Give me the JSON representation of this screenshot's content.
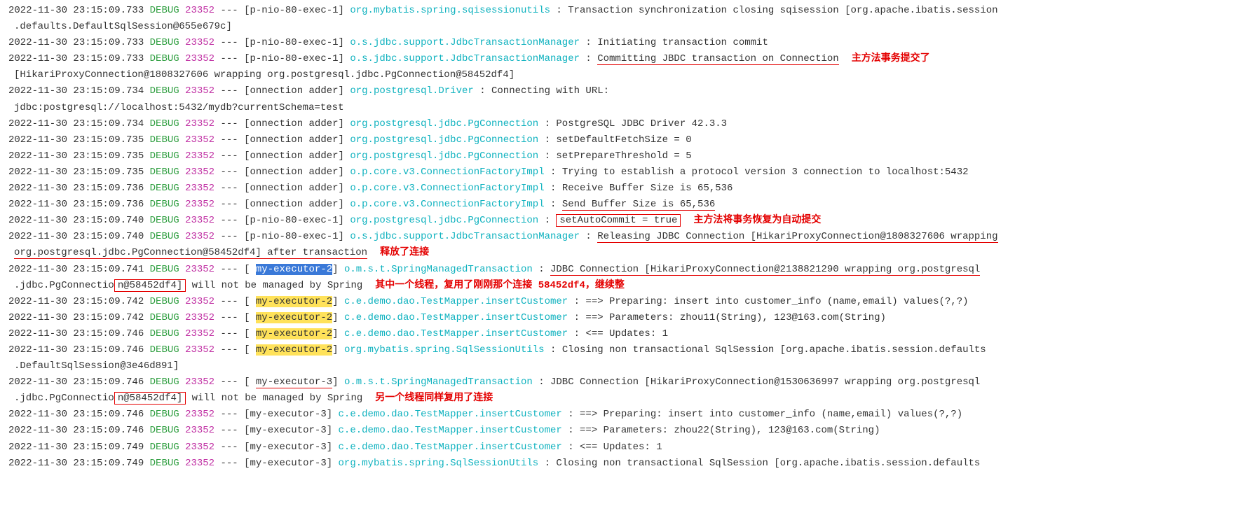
{
  "colors": {
    "timestamp": "#333333",
    "level": "#2e9e3f",
    "pid": "#c02fa3",
    "logger": "#0fb2bf",
    "annotation": "#e40000",
    "hl_blue_bg": "#3a79d8",
    "hl_yellow_bg": "#ffe25a"
  },
  "lines": [
    {
      "ts": "2022-11-30 23:15:09.733",
      "lvl": "DEBUG",
      "pid": "23352",
      "thr": "p-nio-80-exec-1",
      "log": "org.mybatis.spring.sqisessionutils",
      "msg": "Transaction synchronization closing sqisession [org.apache.ibatis.session",
      "cont": ".defaults.DefaultSqlSession@655e679c]"
    },
    {
      "ts": "2022-11-30 23:15:09.733",
      "lvl": "DEBUG",
      "pid": "23352",
      "thr": "p-nio-80-exec-1",
      "log": "o.s.jdbc.support.JdbcTransactionManager",
      "msg": "Initiating transaction commit"
    },
    {
      "ts": "2022-11-30 23:15:09.733",
      "lvl": "DEBUG",
      "pid": "23352",
      "thr": "p-nio-80-exec-1",
      "log": "o.s.jdbc.support.JdbcTransactionManager",
      "msg_ul": "Committing JBDC transaction on Connection",
      "anno": "主方法事务提交了",
      "cont": " [HikariProxyConnection@1808327606 wrapping org.postgresql.jdbc.PgConnection@58452df4]"
    },
    {
      "ts": "2022-11-30 23:15:09.734",
      "lvl": "DEBUG",
      "pid": "23352",
      "thr": "onnection adder",
      "log": "org.postgresql.Driver",
      "msg": "Connecting with URL:",
      "cont": " jdbc:postgresql://localhost:5432/mydb?currentSchema=test"
    },
    {
      "ts": "2022-11-30 23:15:09.734",
      "lvl": "DEBUG",
      "pid": "23352",
      "thr": "onnection adder",
      "log": "org.postgresql.jdbc.PgConnection",
      "msg": "PostgreSQL JDBC Driver 42.3.3"
    },
    {
      "ts": "2022-11-30 23:15:09.735",
      "lvl": "DEBUG",
      "pid": "23352",
      "thr": "onnection adder",
      "log": "org.postgresql.jdbc.PgConnection",
      "msg": "  setDefaultFetchSize = 0"
    },
    {
      "ts": "2022-11-30 23:15:09.735",
      "lvl": "DEBUG",
      "pid": "23352",
      "thr": "onnection adder",
      "log": "org.postgresql.jdbc.PgConnection",
      "msg": "  setPrepareThreshold = 5"
    },
    {
      "ts": "2022-11-30 23:15:09.735",
      "lvl": "DEBUG",
      "pid": "23352",
      "thr": "onnection adder",
      "log": "o.p.core.v3.ConnectionFactoryImpl",
      "msg": "Trying to establish a protocol version 3 connection to localhost:5432"
    },
    {
      "ts": "2022-11-30 23:15:09.736",
      "lvl": "DEBUG",
      "pid": "23352",
      "thr": "onnection adder",
      "log": "o.p.core.v3.ConnectionFactoryImpl",
      "msg": "Receive Buffer Size is 65,536"
    },
    {
      "ts": "2022-11-30 23:15:09.736",
      "lvl": "DEBUG",
      "pid": "23352",
      "thr": "onnection adder",
      "log": "o.p.core.v3.ConnectionFactoryImpl",
      "msg_ul": "Send Buffer Size is 65,536"
    },
    {
      "ts": "2022-11-30 23:15:09.740",
      "lvl": "DEBUG",
      "pid": "23352",
      "thr": "p-nio-80-exec-1",
      "log": "org.postgresql.jdbc.PgConnection",
      "msg_box": "  setAutoCommit = true",
      "anno": "主方法将事务恢复为自动提交"
    },
    {
      "ts": "2022-11-30 23:15:09.740",
      "lvl": "DEBUG",
      "pid": "23352",
      "thr": "p-nio-80-exec-1",
      "log": "o.s.jdbc.support.JdbcTransactionManager",
      "msg_ul": "Releasing JDBC Connection [HikariProxyConnection@1808327606 wrapping",
      "cont_ul": " org.postgresql.jdbc.PgConnection@58452df4] after transaction",
      "anno_cont": "释放了连接"
    },
    {
      "ts": "2022-11-30 23:15:09.741",
      "lvl": "DEBUG",
      "pid": "23352",
      "thr_hl_blue": "my-executor-2",
      "log": "o.m.s.t.SpringManagedTransaction",
      "msg_ul": "JDBC Connection [HikariProxyConnection@2138821290 wrapping org.postgresql",
      "cont_pre": ".jdbc.PgConnectio",
      "cont_box": "n@58452df4]",
      "cont_post": " will not be managed by Spring",
      "anno_cont": "其中一个线程，复用了刚刚那个连接 58452df4，继续整"
    },
    {
      "ts": "2022-11-30 23:15:09.742",
      "lvl": "DEBUG",
      "pid": "23352",
      "thr_hl_yellow": "my-executor-2",
      "log": "c.e.demo.dao.TestMapper.insertCustomer",
      "msg": "==>  Preparing: insert into customer_info (name,email) values(?,?)"
    },
    {
      "ts": "2022-11-30 23:15:09.742",
      "lvl": "DEBUG",
      "pid": "23352",
      "thr_hl_yellow": "my-executor-2",
      "log": "c.e.demo.dao.TestMapper.insertCustomer",
      "msg": "==> Parameters: zhou11(String), 123@163.com(String)"
    },
    {
      "ts": "2022-11-30 23:15:09.746",
      "lvl": "DEBUG",
      "pid": "23352",
      "thr_hl_yellow": "my-executor-2",
      "log": "c.e.demo.dao.TestMapper.insertCustomer",
      "msg": "<==    Updates: 1"
    },
    {
      "ts": "2022-11-30 23:15:09.746",
      "lvl": "DEBUG",
      "pid": "23352",
      "thr_hl_yellow": "my-executor-2",
      "log": "org.mybatis.spring.SqlSessionUtils",
      "msg": "Closing non transactional SqlSession [org.apache.ibatis.session.defaults",
      "cont": ".DefaultSqlSession@3e46d891]"
    },
    {
      "ts": "2022-11-30 23:15:09.746",
      "lvl": "DEBUG",
      "pid": "23352",
      "thr_ul": "my-executor-3",
      "log": "o.m.s.t.SpringManagedTransaction",
      "msg": "JDBC Connection [HikariProxyConnection@1530636997 wrapping org.postgresql",
      "cont_pre": ".jdbc.PgConnectio",
      "cont_box": "n@58452df4]",
      "cont_post": " will not be managed by Spring",
      "anno_cont": "另一个线程同样复用了连接"
    },
    {
      "ts": "2022-11-30 23:15:09.746",
      "lvl": "DEBUG",
      "pid": "23352",
      "thr": "my-executor-3",
      "log": "c.e.demo.dao.TestMapper.insertCustomer",
      "msg": "==>  Preparing: insert into customer_info (name,email) values(?,?)"
    },
    {
      "ts": "2022-11-30 23:15:09.746",
      "lvl": "DEBUG",
      "pid": "23352",
      "thr": "my-executor-3",
      "log": "c.e.demo.dao.TestMapper.insertCustomer",
      "msg": "==> Parameters: zhou22(String), 123@163.com(String)"
    },
    {
      "ts": "2022-11-30 23:15:09.749",
      "lvl": "DEBUG",
      "pid": "23352",
      "thr": "my-executor-3",
      "log": "c.e.demo.dao.TestMapper.insertCustomer",
      "msg": "<==    Updates: 1"
    },
    {
      "ts": "2022-11-30 23:15:09.749",
      "lvl": "DEBUG",
      "pid": "23352",
      "thr": "my-executor-3",
      "log": "org.mybatis.spring.SqlSessionUtils",
      "msg": "Closing non transactional SqlSession [org.apache.ibatis.session.defaults"
    }
  ],
  "loggerColWidth": 44
}
